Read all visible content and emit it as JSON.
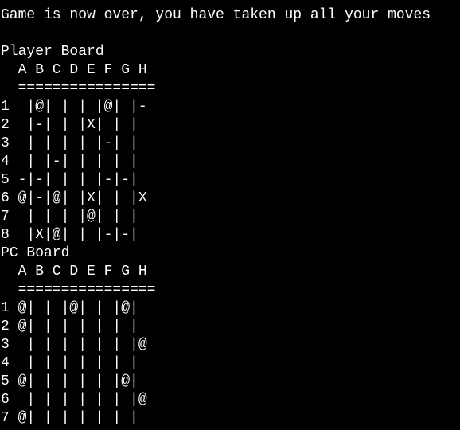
{
  "terminal": {
    "background": "#000000",
    "foreground": "#ffffff",
    "status_message": "Game is now over, you have taken up all your moves",
    "player_board": {
      "title": "Player Board",
      "header": "  A B C D E F G H",
      "separator": "  ================",
      "rows": [
        "1  |@| | | |@| |-",
        "2  |-| | |X| | |",
        "3  | | | | |-| |",
        "4  | |-| | | | |",
        "5 -|-| | | |-|-|",
        "6 @|-|@| |X| | |X",
        "7  | | | |@| | |",
        "8  |X|@| | |-|-|"
      ]
    },
    "pc_board": {
      "title": "PC Board",
      "header": "  A B C D E F G H",
      "separator": "  ================",
      "rows": [
        "1 @| | |@| | |@|",
        "2 @| | | | | | |",
        "3  | | | | | | |@",
        "4  | | | | | | |",
        "5 @| | | | | |@|",
        "6  | | | | | | |@",
        "7 @| | | | | | |"
      ]
    }
  }
}
